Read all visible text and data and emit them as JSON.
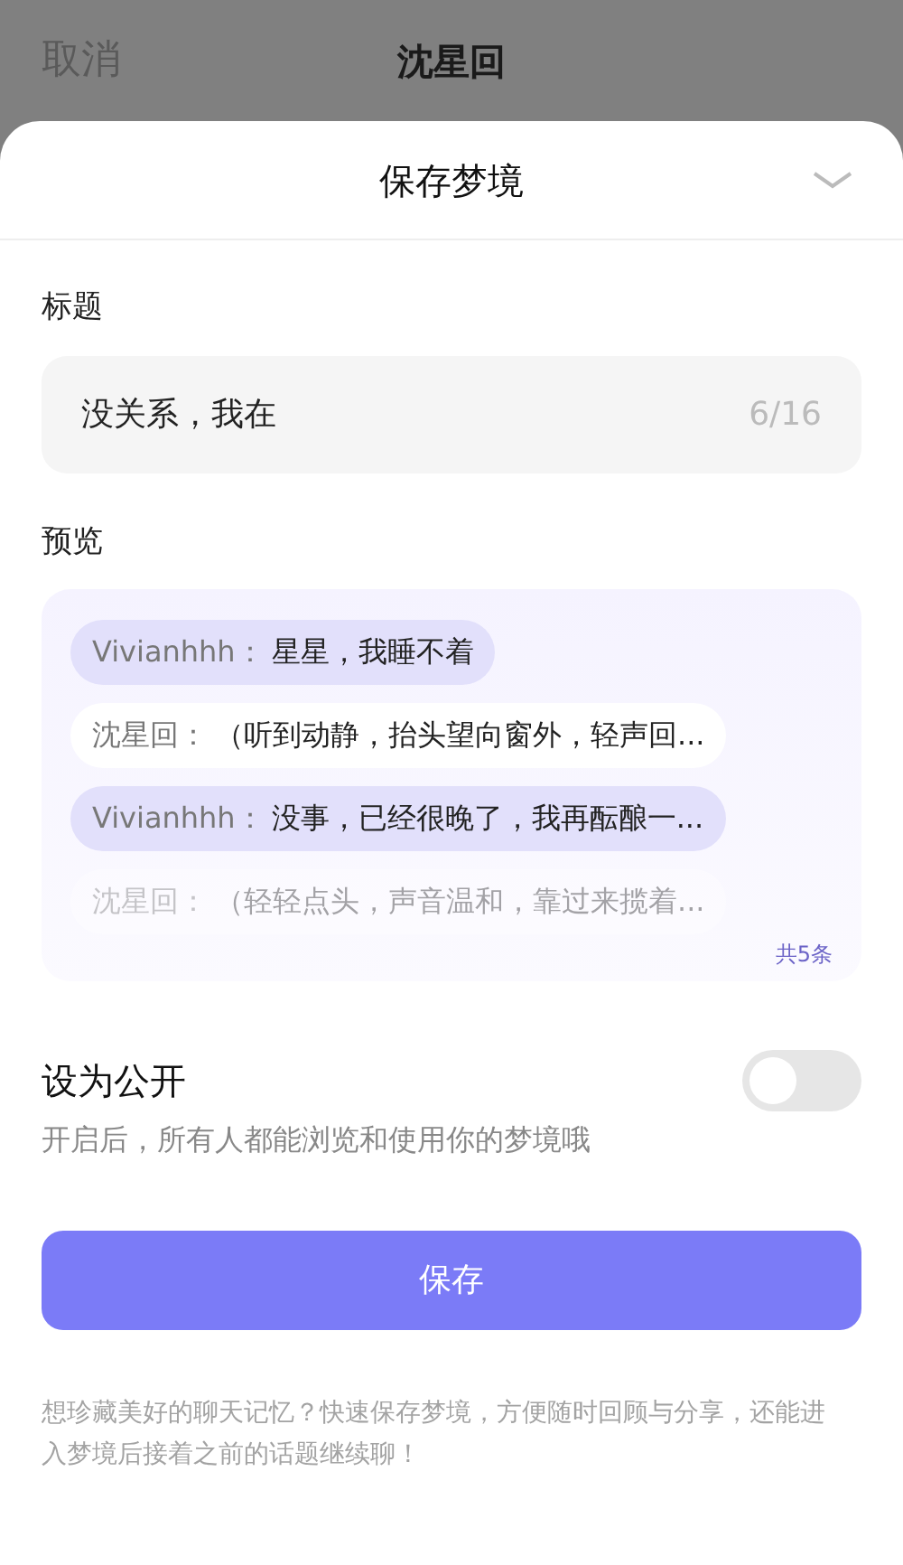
{
  "header": {
    "cancel": "取消",
    "title": "沈星回"
  },
  "sheet": {
    "title": "保存梦境"
  },
  "title_field": {
    "label": "标题",
    "value": "没关系，我在",
    "counter": "6/16"
  },
  "preview": {
    "label": "预览",
    "count": "共5条",
    "messages": [
      {
        "kind": "user",
        "speaker": "Vivianhhh：",
        "text": "星星，我睡不着",
        "faded": false
      },
      {
        "kind": "character",
        "speaker": "沈星回：",
        "text": "（听到动静，抬头望向窗外，轻声回...",
        "faded": false
      },
      {
        "kind": "user",
        "speaker": "Vivianhhh：",
        "text": "没事，已经很晚了，我再酝酿一...",
        "faded": false
      },
      {
        "kind": "character",
        "speaker": "沈星回：",
        "text": "（轻轻点头，声音温和，靠过来揽着...",
        "faded": true
      }
    ]
  },
  "public": {
    "label": "设为公开",
    "description": "开启后，所有人都能浏览和使用你的梦境哦",
    "on": false
  },
  "save_button": "保存",
  "footer": "想珍藏美好的聊天记忆？快速保存梦境，方便随时回顾与分享，还能进入梦境后接着之前的话题继续聊！"
}
